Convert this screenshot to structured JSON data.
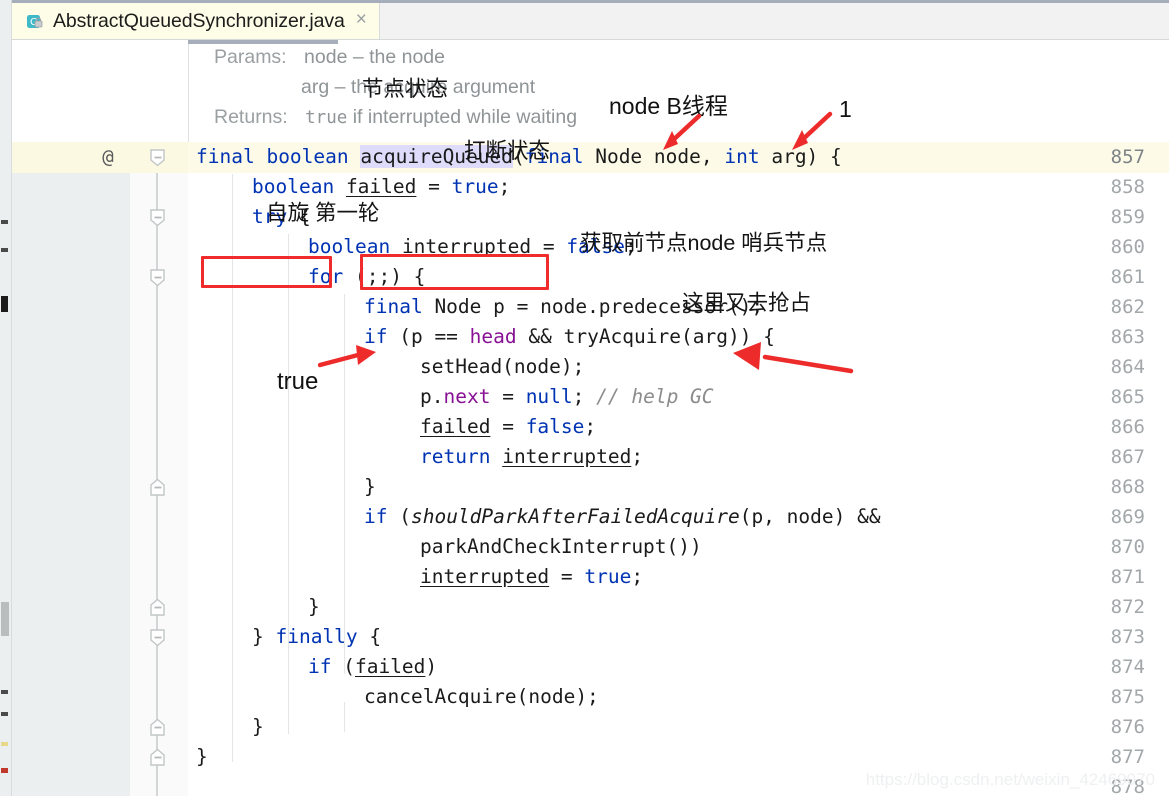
{
  "window": {
    "tab": {
      "label": "AbstractQueuedSynchronizer.java",
      "icon": "java-class-icon",
      "close_label": "×"
    }
  },
  "doc_popup": {
    "rows": [
      {
        "label": "Params:",
        "value": "node – the node"
      },
      {
        "label": "",
        "value": "arg – the acquire argument"
      },
      {
        "label": "Returns:",
        "mono": "true",
        "value": " if interrupted while waiting"
      }
    ]
  },
  "editor": {
    "language": "java",
    "first_line": 857,
    "current_line": 857,
    "annotation_marker": "@",
    "line_numbers": [
      857,
      858,
      859,
      860,
      861,
      862,
      863,
      864,
      865,
      866,
      867,
      868,
      869,
      870,
      871,
      872,
      873,
      874,
      875,
      876,
      877,
      878
    ],
    "fold_markers": [
      {
        "line": 857,
        "dir": "down"
      },
      {
        "line": 859,
        "dir": "down"
      },
      {
        "line": 861,
        "dir": "down"
      },
      {
        "line": 868,
        "dir": "up"
      },
      {
        "line": 872,
        "dir": "up"
      },
      {
        "line": 873,
        "dir": "down"
      },
      {
        "line": 876,
        "dir": "up"
      },
      {
        "line": 877,
        "dir": "up"
      }
    ],
    "lines": [
      {
        "n": 857,
        "indent": 0,
        "tokens": [
          {
            "t": "final",
            "c": "kw"
          },
          {
            "t": " ",
            "c": "plain"
          },
          {
            "t": "boolean",
            "c": "kw"
          },
          {
            "t": " ",
            "c": "plain"
          },
          {
            "t": "acquireQueued",
            "c": "hl"
          },
          {
            "t": "(",
            "c": "plain"
          },
          {
            "t": "final",
            "c": "kw"
          },
          {
            "t": " Node node, ",
            "c": "plain"
          },
          {
            "t": "int",
            "c": "kw"
          },
          {
            "t": " arg) {",
            "c": "plain"
          }
        ]
      },
      {
        "n": 858,
        "indent": 1,
        "tokens": [
          {
            "t": "boolean",
            "c": "kw"
          },
          {
            "t": " ",
            "c": "plain"
          },
          {
            "t": "failed",
            "c": "loc"
          },
          {
            "t": " = ",
            "c": "plain"
          },
          {
            "t": "true",
            "c": "kw"
          },
          {
            "t": ";",
            "c": "plain"
          }
        ]
      },
      {
        "n": 859,
        "indent": 1,
        "tokens": [
          {
            "t": "try",
            "c": "kw"
          },
          {
            "t": " {",
            "c": "plain"
          }
        ]
      },
      {
        "n": 860,
        "indent": 2,
        "tokens": [
          {
            "t": "boolean",
            "c": "kw"
          },
          {
            "t": " ",
            "c": "plain"
          },
          {
            "t": "interrupted",
            "c": "loc"
          },
          {
            "t": " = ",
            "c": "plain"
          },
          {
            "t": "false",
            "c": "kw"
          },
          {
            "t": ";",
            "c": "plain"
          }
        ]
      },
      {
        "n": 861,
        "indent": 2,
        "tokens": [
          {
            "t": "for",
            "c": "kw"
          },
          {
            "t": " (;;) {",
            "c": "plain"
          }
        ]
      },
      {
        "n": 862,
        "indent": 3,
        "tokens": [
          {
            "t": "final",
            "c": "kw"
          },
          {
            "t": " Node p = node.predecessor();",
            "c": "plain"
          }
        ]
      },
      {
        "n": 863,
        "indent": 3,
        "tokens": [
          {
            "t": "if",
            "c": "kw"
          },
          {
            "t": " (p == ",
            "c": "plain"
          },
          {
            "t": "head",
            "c": "fld"
          },
          {
            "t": " && tryAcquire(arg)) {",
            "c": "plain"
          }
        ]
      },
      {
        "n": 864,
        "indent": 4,
        "tokens": [
          {
            "t": "setHead(node);",
            "c": "plain"
          }
        ]
      },
      {
        "n": 865,
        "indent": 4,
        "tokens": [
          {
            "t": "p.",
            "c": "plain"
          },
          {
            "t": "next",
            "c": "fld"
          },
          {
            "t": " = ",
            "c": "plain"
          },
          {
            "t": "null",
            "c": "kw"
          },
          {
            "t": "; ",
            "c": "plain"
          },
          {
            "t": "// help GC",
            "c": "cmt"
          }
        ]
      },
      {
        "n": 866,
        "indent": 4,
        "tokens": [
          {
            "t": "failed",
            "c": "loc"
          },
          {
            "t": " = ",
            "c": "plain"
          },
          {
            "t": "false",
            "c": "kw"
          },
          {
            "t": ";",
            "c": "plain"
          }
        ]
      },
      {
        "n": 867,
        "indent": 4,
        "tokens": [
          {
            "t": "return",
            "c": "kw"
          },
          {
            "t": " ",
            "c": "plain"
          },
          {
            "t": "interrupted",
            "c": "loc"
          },
          {
            "t": ";",
            "c": "plain"
          }
        ]
      },
      {
        "n": 868,
        "indent": 3,
        "tokens": [
          {
            "t": "}",
            "c": "plain"
          }
        ]
      },
      {
        "n": 869,
        "indent": 3,
        "tokens": [
          {
            "t": "if",
            "c": "kw"
          },
          {
            "t": " (",
            "c": "plain"
          },
          {
            "t": "shouldParkAfterFailedAcquire",
            "c": "ital"
          },
          {
            "t": "(p, node) &&",
            "c": "plain"
          }
        ]
      },
      {
        "n": 870,
        "indent": 4,
        "tokens": [
          {
            "t": "parkAndCheckInterrupt())",
            "c": "plain"
          }
        ]
      },
      {
        "n": 871,
        "indent": 4,
        "tokens": [
          {
            "t": "interrupted",
            "c": "loc"
          },
          {
            "t": " = ",
            "c": "plain"
          },
          {
            "t": "true",
            "c": "kw"
          },
          {
            "t": ";",
            "c": "plain"
          }
        ]
      },
      {
        "n": 872,
        "indent": 2,
        "tokens": [
          {
            "t": "}",
            "c": "plain"
          }
        ]
      },
      {
        "n": 873,
        "indent": 1,
        "tokens": [
          {
            "t": "} ",
            "c": "plain"
          },
          {
            "t": "finally",
            "c": "kw"
          },
          {
            "t": " {",
            "c": "plain"
          }
        ]
      },
      {
        "n": 874,
        "indent": 2,
        "tokens": [
          {
            "t": "if",
            "c": "kw"
          },
          {
            "t": " (",
            "c": "plain"
          },
          {
            "t": "failed",
            "c": "loc"
          },
          {
            "t": ")",
            "c": "plain"
          }
        ]
      },
      {
        "n": 875,
        "indent": 3,
        "tokens": [
          {
            "t": "cancelAcquire(node);",
            "c": "plain"
          }
        ]
      },
      {
        "n": 876,
        "indent": 1,
        "tokens": [
          {
            "t": "}",
            "c": "plain"
          }
        ]
      },
      {
        "n": 877,
        "indent": 0,
        "tokens": [
          {
            "t": "}",
            "c": "plain"
          }
        ]
      },
      {
        "n": 878,
        "indent": 0,
        "tokens": []
      }
    ]
  },
  "annotations": {
    "node_b_thread": "node B线程",
    "arg_value": "1",
    "node_state": "节点状态",
    "interrupt_state": "打断状态",
    "spin_first_round": "自旋 第一轮",
    "get_predecessor": "获取前节点node 哨兵节点",
    "preempt_again": "这里又去抢占",
    "true_label": "true"
  },
  "colors": {
    "annotation_red": "#ef2b2b",
    "keyword_blue": "#0033b3",
    "field_purple": "#871094",
    "comment_gray": "#8c8c8c",
    "current_line": "#fdfbe8",
    "gutter_bg": "#eceff0",
    "tab_active_bg": "#fdfde8"
  },
  "watermark": "https://blog.csdn.net/weixin_42469070"
}
